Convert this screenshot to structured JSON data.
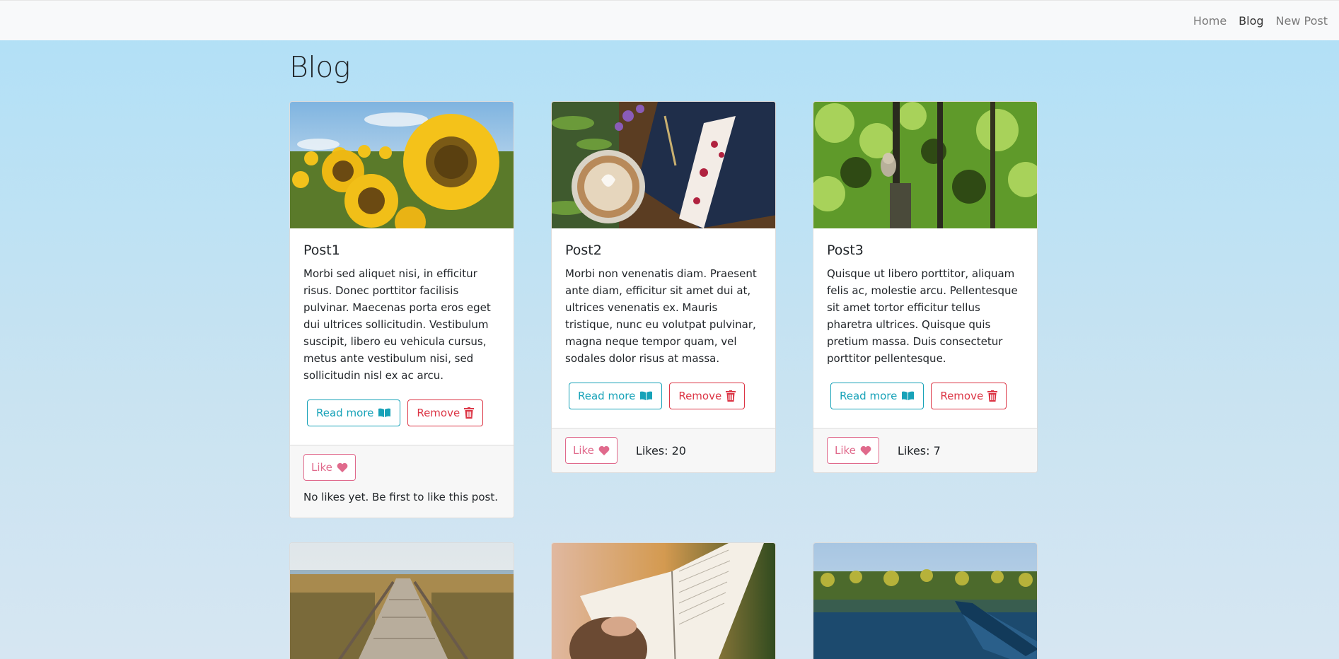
{
  "nav": {
    "links": [
      {
        "label": "Home"
      },
      {
        "label": "Blog"
      },
      {
        "label": "New Post"
      }
    ]
  },
  "page": {
    "title": "Blog"
  },
  "posts": [
    {
      "title": "Post1",
      "text": "Morbi sed aliquet nisi, in efficitur risus. Donec porttitor facilisis pulvinar. Maecenas porta eros eget dui ultrices sollicitudin. Vestibulum suscipit, libero eu vehicula cursus, metus ante vestibulum nisi, sed sollicitudin nisl ex ac arcu.",
      "read_more": "Read more",
      "remove": "Remove",
      "like": "Like",
      "likes_text": "No likes yet. Be first to like this post.",
      "image": "sunflowers"
    },
    {
      "title": "Post2",
      "text": "Morbi non venenatis diam. Praesent ante diam, efficitur sit amet dui at, ultrices venenatis ex. Mauris tristique, nunc eu volutpat pulvinar, magna neque tempor quam, vel sodales dolor risus at massa.",
      "read_more": "Read more",
      "remove": "Remove",
      "like": "Like",
      "likes_text": "Likes: 20",
      "image": "coffee and cake"
    },
    {
      "title": "Post3",
      "text": "Quisque ut libero porttitor, aliquam felis ac, molestie arcu. Pellentesque sit amet tortor efficitur tellus pharetra ultrices. Quisque quis pretium massa. Duis consectetur porttitor pellentesque.",
      "read_more": "Read more",
      "remove": "Remove",
      "like": "Like",
      "likes_text": "Likes: 7",
      "image": "owl in forest"
    },
    {
      "image": "boardwalk to beach"
    },
    {
      "image": "reading a book"
    },
    {
      "image": "lake with canoe"
    }
  ],
  "icons": {
    "read_more": "book-open-icon",
    "remove": "trash-icon",
    "like": "heart-icon"
  },
  "colors": {
    "info": "#17a2b8",
    "danger": "#dc3545",
    "like": "#e06a8c",
    "navbar": "#f8f9fa"
  }
}
